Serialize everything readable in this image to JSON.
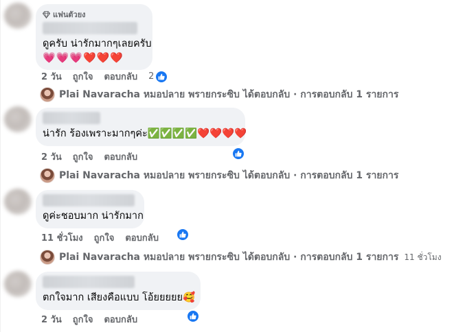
{
  "comments": [
    {
      "badge": "แฟนตัวยง",
      "text": "ดูครับ น่ารักมากๆเลยครับ",
      "emojis": "💗💗💗❤️❤️❤️",
      "time": "2 วัน",
      "like": "ถูกใจ",
      "reply": "ตอบกลับ",
      "like_count": "2"
    },
    {
      "text": "น่ารัก ร้องเพราะมากๆค่ะ✅✅✅✅❤️❤️❤️❤️",
      "time": "2 วัน",
      "like": "ถูกใจ",
      "reply": "ตอบกลับ"
    },
    {
      "text": "ดูค่ะชอบมาก น่ารักมาก",
      "time": "11 ชั่วโมง",
      "like": "ถูกใจ",
      "reply": "ตอบกลับ"
    },
    {
      "text": "ตกใจมาก เสียงคือแบบ โอ้ยยยยย🥰",
      "time": "2 วัน",
      "like": "ถูกใจ",
      "reply": "ตอบกลับ"
    }
  ],
  "replies": [
    {
      "text": "Plai Navaracha หมอปลาย พรายกระซิบ ได้ตอบกลับ · การตอบกลับ 1 รายการ",
      "time": ""
    },
    {
      "text": "Plai Navaracha หมอปลาย พรายกระซิบ ได้ตอบกลับ · การตอบกลับ 1 รายการ",
      "time": ""
    },
    {
      "text": "Plai Navaracha หมอปลาย พรายกระซิบ ได้ตอบกลับ · การตอบกลับ 1 รายการ",
      "time": "11 ชั่วโมง"
    }
  ],
  "colors": {
    "bubble": "#f0f2f5",
    "meta": "#65676b",
    "like_blue": "#1877f2"
  },
  "icons": {
    "badge": "diamond-icon",
    "like": "thumbs-up-icon"
  }
}
